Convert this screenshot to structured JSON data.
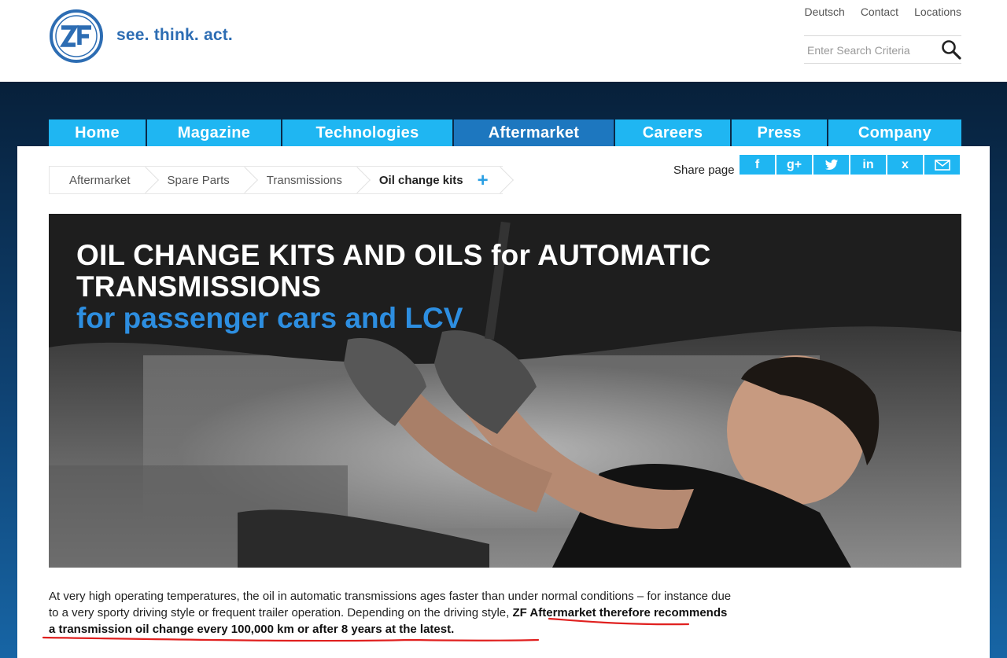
{
  "brand": {
    "logo_text": "ZF",
    "tagline": "see. think. act."
  },
  "utility_links": [
    "Deutsch",
    "Contact",
    "Locations"
  ],
  "search": {
    "placeholder": "Enter Search Criteria"
  },
  "nav": [
    {
      "label": "Home",
      "active": false
    },
    {
      "label": "Magazine",
      "active": false
    },
    {
      "label": "Technologies",
      "active": false
    },
    {
      "label": "Aftermarket",
      "active": true
    },
    {
      "label": "Careers",
      "active": false
    },
    {
      "label": "Press",
      "active": false
    },
    {
      "label": "Company",
      "active": false
    }
  ],
  "breadcrumb": [
    "Aftermarket",
    "Spare Parts",
    "Transmissions",
    "Oil change kits"
  ],
  "share": {
    "label": "Share page",
    "buttons": [
      {
        "icon": "facebook-icon",
        "glyph": "f"
      },
      {
        "icon": "google-plus-icon",
        "glyph": "g+"
      },
      {
        "icon": "twitter-icon",
        "glyph": "🐦"
      },
      {
        "icon": "linkedin-icon",
        "glyph": "in"
      },
      {
        "icon": "xing-icon",
        "glyph": "x"
      },
      {
        "icon": "mail-icon",
        "glyph": "✉"
      }
    ]
  },
  "hero": {
    "title": "OIL CHANGE KITS AND OILS for AUTOMATIC TRANSMISSIONS",
    "subtitle": "for passenger cars and LCV"
  },
  "intro": {
    "plain": "At very high operating temperatures, the oil in automatic transmissions ages faster than under normal conditions – for instance due to a very sporty driving style or frequent trailer operation. Depending on the driving style, ",
    "bold": "ZF Aftermarket therefore recommends a transmission oil change every 100,000 km or after 8 years at the latest."
  },
  "colors": {
    "brand_blue": "#2d6db3",
    "nav_blue": "#1fb6f2",
    "nav_active": "#1d77bf",
    "annotation_red": "#e0201f"
  }
}
